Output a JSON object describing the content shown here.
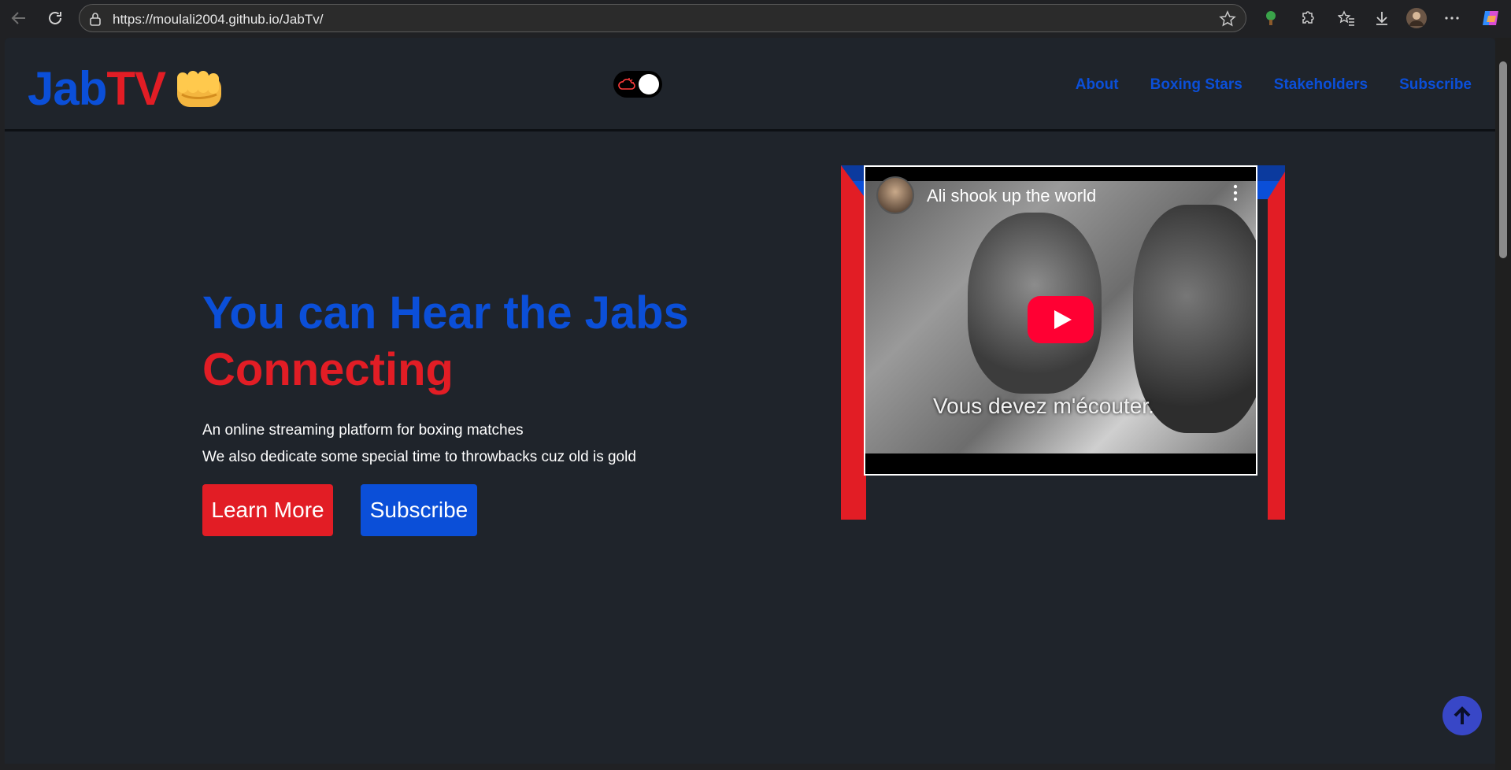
{
  "browser": {
    "url": "https://moulali2004.github.io/JabTv/"
  },
  "header": {
    "logo_part1": "Jab",
    "logo_part2": "TV",
    "logo_icon": "oncoming-fist-emoji",
    "theme_toggle": "dark-mode-toggle",
    "nav": [
      "About",
      "Boxing Stars",
      "Stakeholders",
      "Subscribe"
    ]
  },
  "hero": {
    "title_line1": "You can Hear the Jabs",
    "title_line2": "Connecting",
    "text_line1": "An online streaming platform for boxing matches",
    "text_line2": "We also dedicate some special time to throwbacks cuz old is gold",
    "learn_more_label": "Learn More",
    "subscribe_label": "Subscribe"
  },
  "video": {
    "title": "Ali shook up the world",
    "subtitle": "Vous devez m'écouter."
  },
  "colors": {
    "blue": "#0b4fd8",
    "red": "#e21d25",
    "background": "#1f242b",
    "scroll_top": "#3847c7"
  }
}
